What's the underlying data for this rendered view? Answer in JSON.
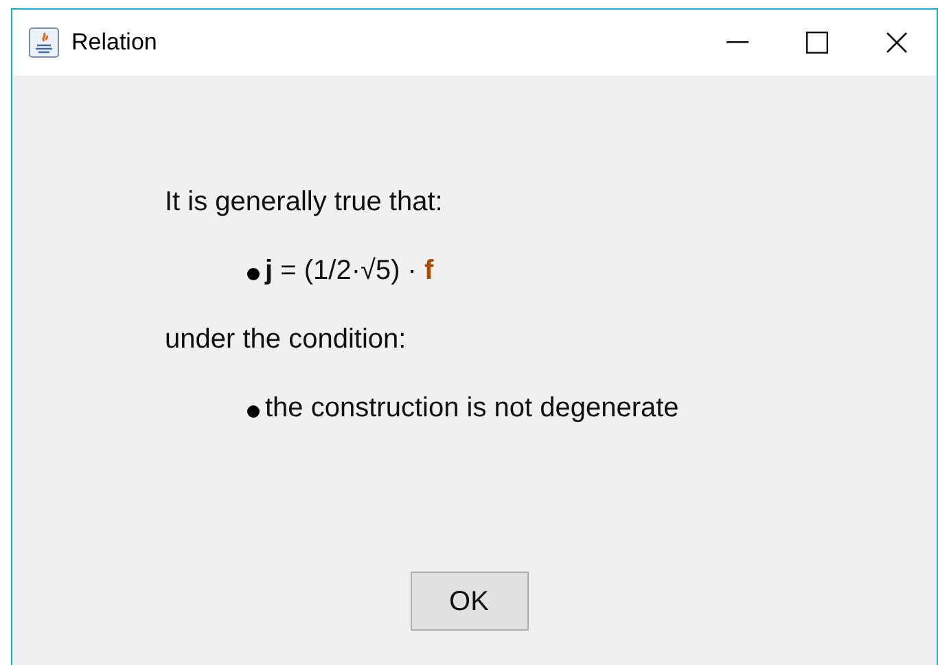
{
  "window": {
    "title": "Relation"
  },
  "statement": {
    "intro": "It is generally true that:",
    "formula": [
      {
        "text": "j",
        "bold": true
      },
      {
        "text": " = (1/2·√5) · ",
        "bold": false
      },
      {
        "text": "f",
        "bold": true,
        "color": "#a64b00"
      }
    ],
    "condition_intro": "under the condition:",
    "conditions": [
      "the construction is not degenerate"
    ]
  },
  "buttons": [
    "OK"
  ]
}
